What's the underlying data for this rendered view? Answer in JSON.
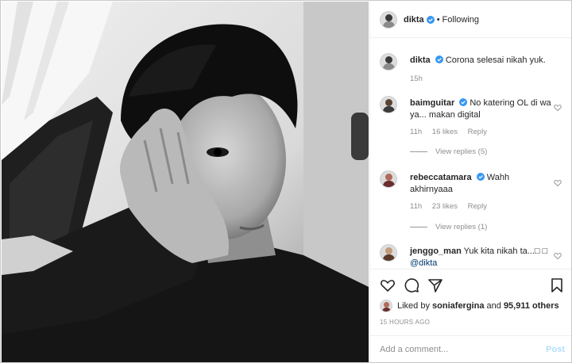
{
  "post": {
    "author": "dikta",
    "follow_status": "Following",
    "dot": "•",
    "caption": {
      "username": "dikta",
      "text": "Corona selesai nikah yuk.",
      "time": "15h"
    }
  },
  "comments": [
    {
      "username": "baimguitar",
      "text": "No katering OL di wa ya... makan digital",
      "time": "11h",
      "likes": "16 likes",
      "reply": "Reply",
      "view_replies": "View replies (5)"
    },
    {
      "username": "rebeccatamara",
      "text": "Wahh akhirnyaaa",
      "time": "11h",
      "likes": "23 likes",
      "reply": "Reply",
      "view_replies": "View replies (1)"
    },
    {
      "username": "jenggo_man",
      "text": "Yuk kita nikah ta...□ □",
      "mention": "@dikta"
    }
  ],
  "likes": {
    "prefix": "Liked by",
    "user": "soniafergina",
    "joiner": "and",
    "others": "95,911 others"
  },
  "timestamp": "15 HOURS AGO",
  "add_comment": {
    "placeholder": "Add a comment...",
    "post_label": "Post"
  },
  "icons": [
    "heart-icon",
    "comment-icon",
    "share-icon",
    "bookmark-icon",
    "verified-badge-icon"
  ],
  "colors": {
    "verified": "#3897f0",
    "post_button": "#b2dffc",
    "meta_text": "#8e8e8e"
  }
}
